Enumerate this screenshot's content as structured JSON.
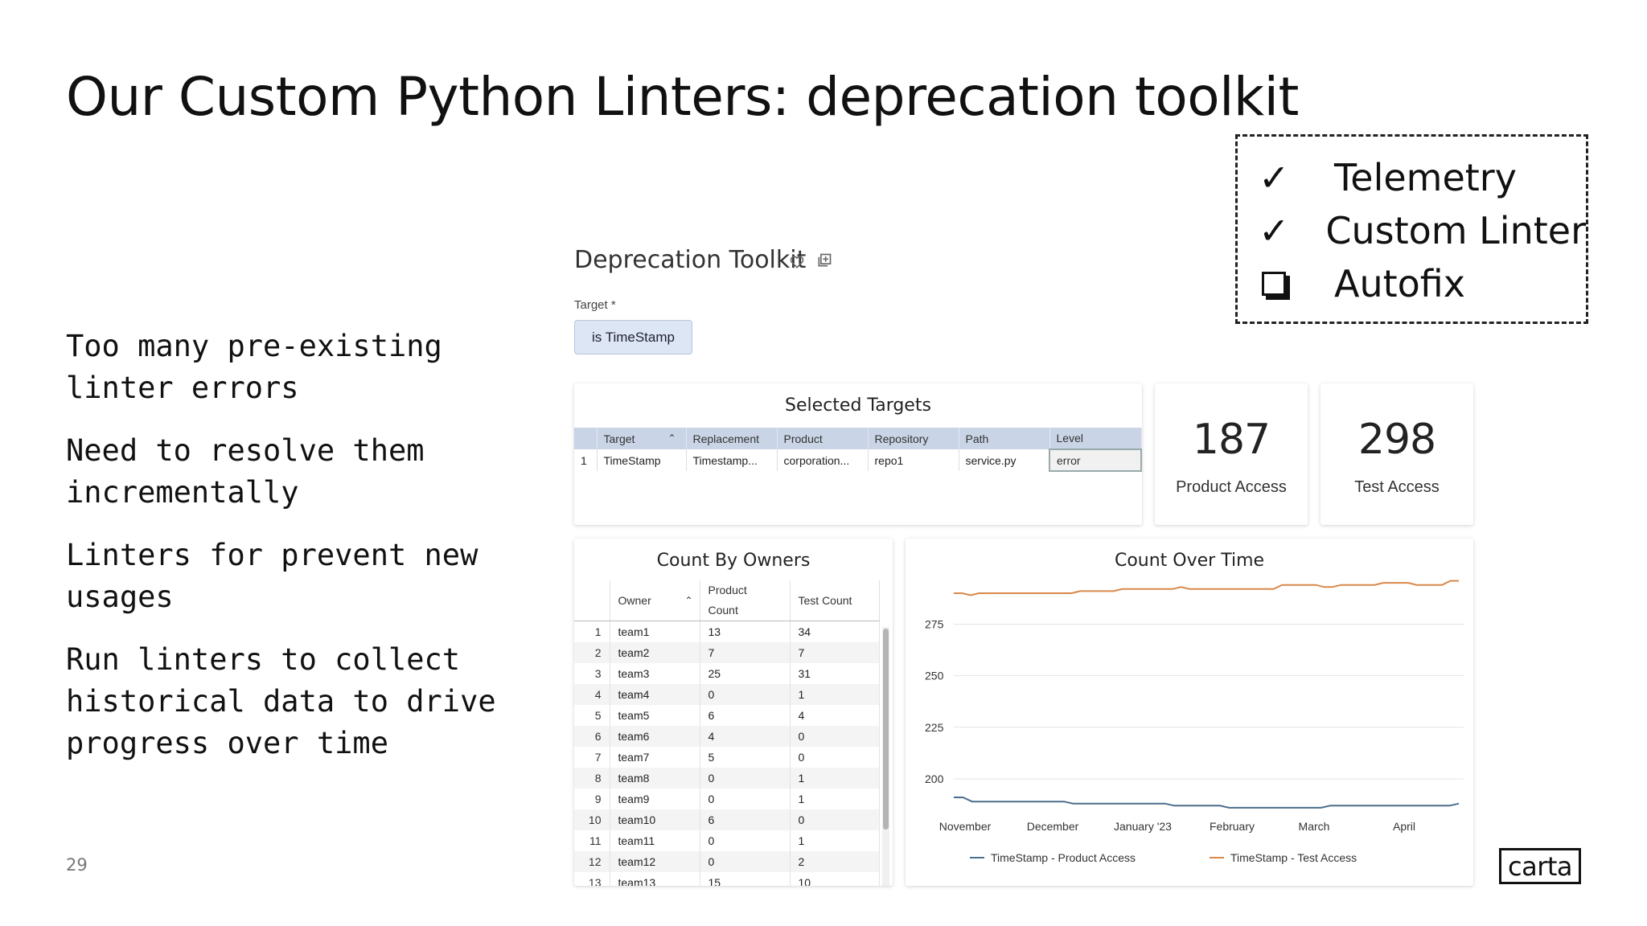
{
  "slide": {
    "title": "Our Custom Python Linters: deprecation toolkit",
    "page_number": "29",
    "logo_text": "carta"
  },
  "checklist": [
    {
      "mark": "✓",
      "label": "Telemetry",
      "checked": true
    },
    {
      "mark": "✓",
      "label": "Custom Linter",
      "checked": true
    },
    {
      "mark": "",
      "label": "Autofix",
      "checked": false
    }
  ],
  "bullets": [
    "Too many pre-existing\nlinter errors",
    "Need to resolve them\nincrementally",
    "Linters for prevent new\nusages",
    "Run linters to collect\nhistorical data to drive\nprogress over time"
  ],
  "dashboard": {
    "title": "Deprecation Toolkit",
    "target_label": "Target *",
    "target_value": "is TimeStamp",
    "selected_targets": {
      "title": "Selected Targets",
      "columns": [
        "Target",
        "Replacement",
        "Product",
        "Repository",
        "Path",
        "Level"
      ],
      "rows": [
        {
          "index": "1",
          "target": "TimeStamp",
          "replacement": "Timestamp...",
          "product": "corporation...",
          "repository": "repo1",
          "path": "service.py",
          "level": "error"
        }
      ]
    },
    "product_access": {
      "value": "187",
      "label": "Product Access"
    },
    "test_access": {
      "value": "298",
      "label": "Test Access"
    },
    "owners": {
      "title": "Count By Owners",
      "columns": {
        "owner": "Owner",
        "product_count_1": "Product",
        "product_count_2": "Count",
        "test_count": "Test Count"
      },
      "rows": [
        [
          "1",
          "team1",
          "13",
          "34"
        ],
        [
          "2",
          "team2",
          "7",
          "7"
        ],
        [
          "3",
          "team3",
          "25",
          "31"
        ],
        [
          "4",
          "team4",
          "0",
          "1"
        ],
        [
          "5",
          "team5",
          "6",
          "4"
        ],
        [
          "6",
          "team6",
          "4",
          "0"
        ],
        [
          "7",
          "team7",
          "5",
          "0"
        ],
        [
          "8",
          "team8",
          "0",
          "1"
        ],
        [
          "9",
          "team9",
          "0",
          "1"
        ],
        [
          "10",
          "team10",
          "6",
          "0"
        ],
        [
          "11",
          "team11",
          "0",
          "1"
        ],
        [
          "12",
          "team12",
          "0",
          "2"
        ],
        [
          "13",
          "team13",
          "15",
          "10"
        ]
      ]
    }
  },
  "chart_data": {
    "type": "line",
    "title": "Count Over Time",
    "x_tick_labels": [
      "November",
      "December",
      "January '23",
      "February",
      "March",
      "April"
    ],
    "y_tick_labels": [
      "275",
      "250",
      "225",
      "200"
    ],
    "ylim": [
      184,
      297
    ],
    "grid": true,
    "legend": "bottom",
    "series": [
      {
        "name": "TimeStamp - Product Access",
        "color": "#4a6d8c",
        "values": [
          191,
          191,
          189,
          189,
          189,
          189,
          189,
          189,
          189,
          189,
          189,
          189,
          189,
          188,
          188,
          188,
          188,
          188,
          188,
          188,
          188,
          188,
          188,
          188,
          187,
          187,
          187,
          187,
          187,
          187,
          186,
          186,
          186,
          186,
          186,
          186,
          186,
          186,
          186,
          186,
          186,
          187,
          187,
          187,
          187,
          187,
          187,
          187,
          187,
          187,
          187,
          187,
          187,
          187,
          187,
          188
        ]
      },
      {
        "name": "TimeStamp - Test Access",
        "color": "#d8884a",
        "values": [
          290,
          290,
          289,
          290,
          290,
          290,
          290,
          290,
          290,
          290,
          290,
          290,
          290,
          290,
          290,
          291,
          291,
          291,
          291,
          291,
          292,
          292,
          292,
          292,
          292,
          292,
          292,
          293,
          292,
          292,
          292,
          292,
          292,
          292,
          292,
          292,
          292,
          292,
          292,
          294,
          294,
          294,
          294,
          294,
          293,
          293,
          294,
          294,
          294,
          294,
          294,
          295,
          295,
          295,
          295,
          294,
          294,
          294,
          294,
          296,
          296
        ]
      }
    ]
  }
}
